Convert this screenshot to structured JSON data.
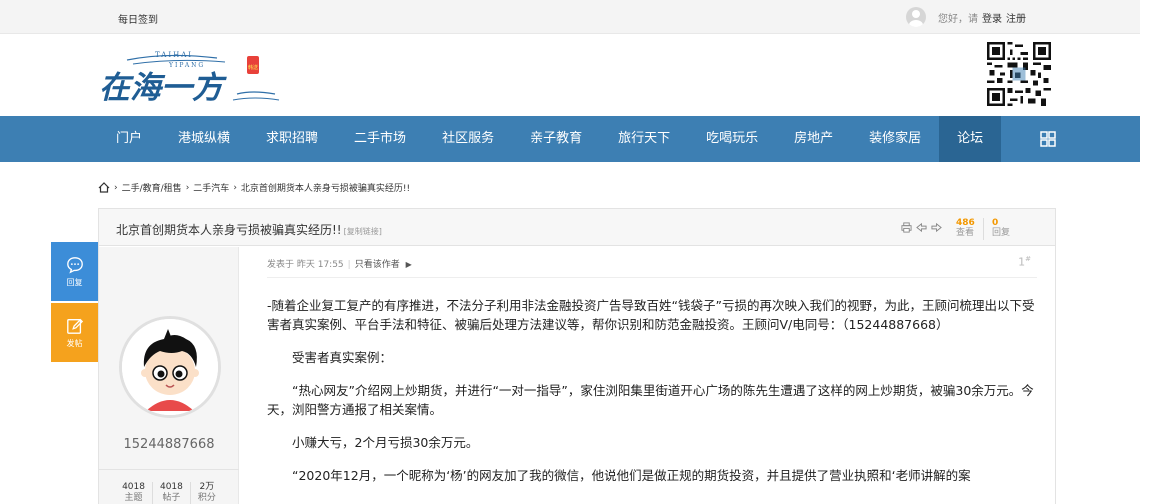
{
  "topbar": {
    "signin": "每日签到",
    "greeting": "您好，请",
    "login": "登录",
    "register": "注册"
  },
  "logo": {
    "cn": "在海一方",
    "en_top": "TAIHAI",
    "en_bottom": "YIPANG",
    "seal": "韩送"
  },
  "nav": {
    "items": [
      "门户",
      "港城纵横",
      "求职招聘",
      "二手市场",
      "社区服务",
      "亲子教育",
      "旅行天下",
      "吃喝玩乐",
      "房地产",
      "装修家居",
      "论坛"
    ],
    "active_index": 10
  },
  "breadcrumb": {
    "items": [
      "二手/教育/租售",
      "二手汽车",
      "北京首创期货本人亲身亏损被骗真实经历!!"
    ]
  },
  "thread": {
    "title": "北京首创期货本人亲身亏损被骗真实经历!!",
    "copy_link": "[复制链接]",
    "views": "486",
    "views_label": "查看",
    "replies": "0",
    "replies_label": "回复"
  },
  "author": {
    "name": "15244887668",
    "stats": [
      {
        "value": "4018",
        "label": "主题"
      },
      {
        "value": "4018",
        "label": "帖子"
      },
      {
        "value": "2万",
        "label": "积分"
      }
    ]
  },
  "post": {
    "meta_posted": "发表于 昨天 17:55",
    "meta_author_only": "只看该作者",
    "floor": "1",
    "floor_sup": "#",
    "paragraphs": [
      "-随着企业复工复产的有序推进，不法分子利用非法金融投资广告导致百姓“钱袋子”亏损的再次映入我们的视野，为此，王顾问梳理出以下受害者真实案例、平台手法和特征、被骗后处理方法建议等，帮你识别和防范金融投资。王顾问V/电同号：（15244887668）",
      "受害者真实案例：",
      "“热心网友”介绍网上炒期货，并进行“一对一指导”，家住浏阳集里街道开心广场的陈先生遭遇了这样的网上炒期货，被骗30余万元。今天，浏阳警方通报了相关案情。",
      "小赚大亏，2个月亏损30余万元。",
      "“2020年12月，一个昵称为‘杨’的网友加了我的微信，他说他们是做正规的期货投资，并且提供了营业执照和‘老师讲解的案"
    ]
  },
  "side": {
    "reply": "回复",
    "post": "发帖"
  },
  "colors": {
    "nav_bg": "#3d7fb3",
    "nav_active": "#2a6593",
    "reply_btn": "#3c8dd8",
    "post_btn": "#f5a21d",
    "stat_number": "#f39800"
  }
}
